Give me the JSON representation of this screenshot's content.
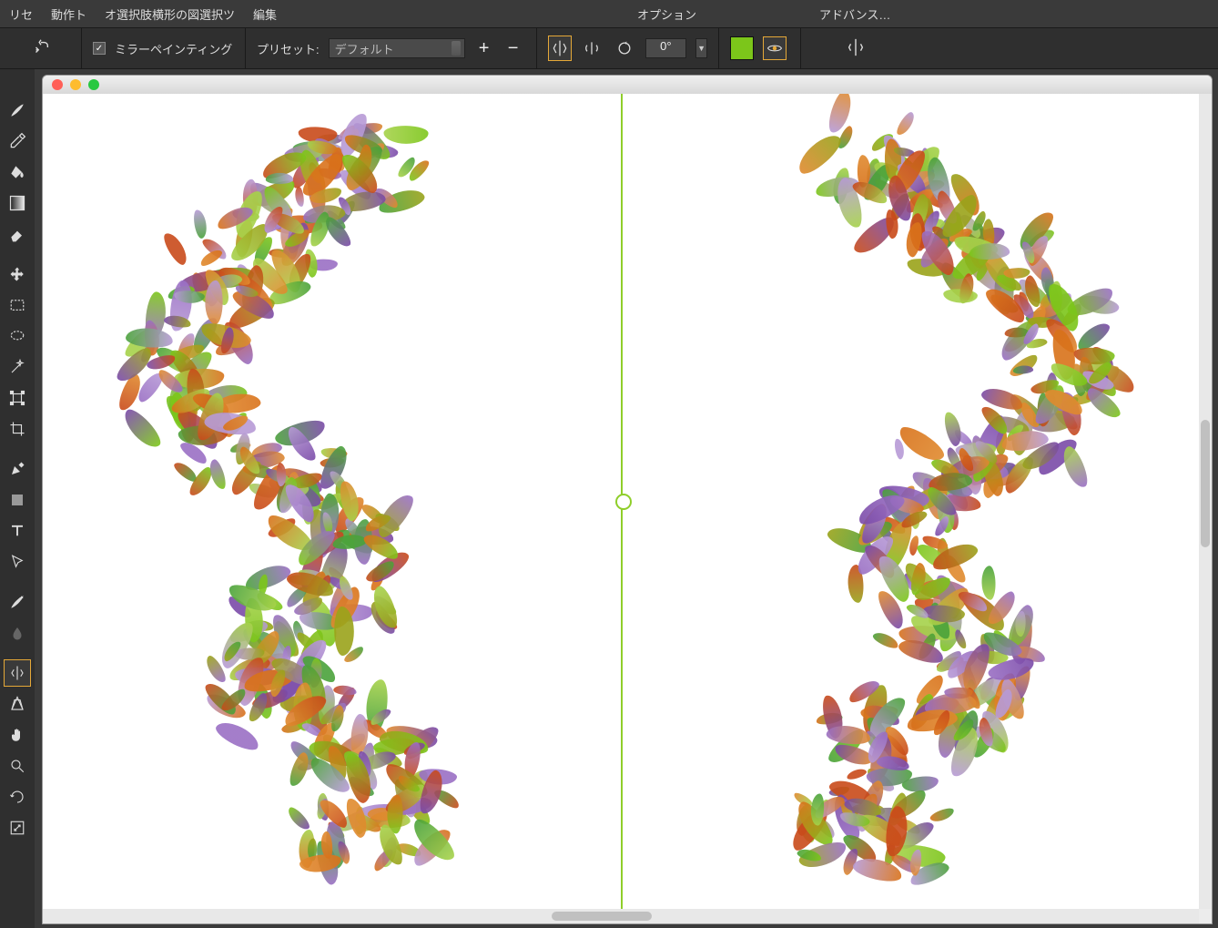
{
  "menus": {
    "reset": "リセ",
    "action": "動作ト",
    "select_box": "オ選択肢横形の図選択ツ",
    "edit": "編集",
    "options": "オプション",
    "advanced": "アドバンス…"
  },
  "option_bar": {
    "mirror_painting_label": "ミラーペインティング",
    "preset_label": "プリセット:",
    "preset_value": "デフォルト",
    "plus": "+",
    "minus": "−",
    "angle_value": "0°",
    "color_swatch": "#7cc61a"
  },
  "mirror_painting_checked": true,
  "selected_tool": "mirror-tool"
}
